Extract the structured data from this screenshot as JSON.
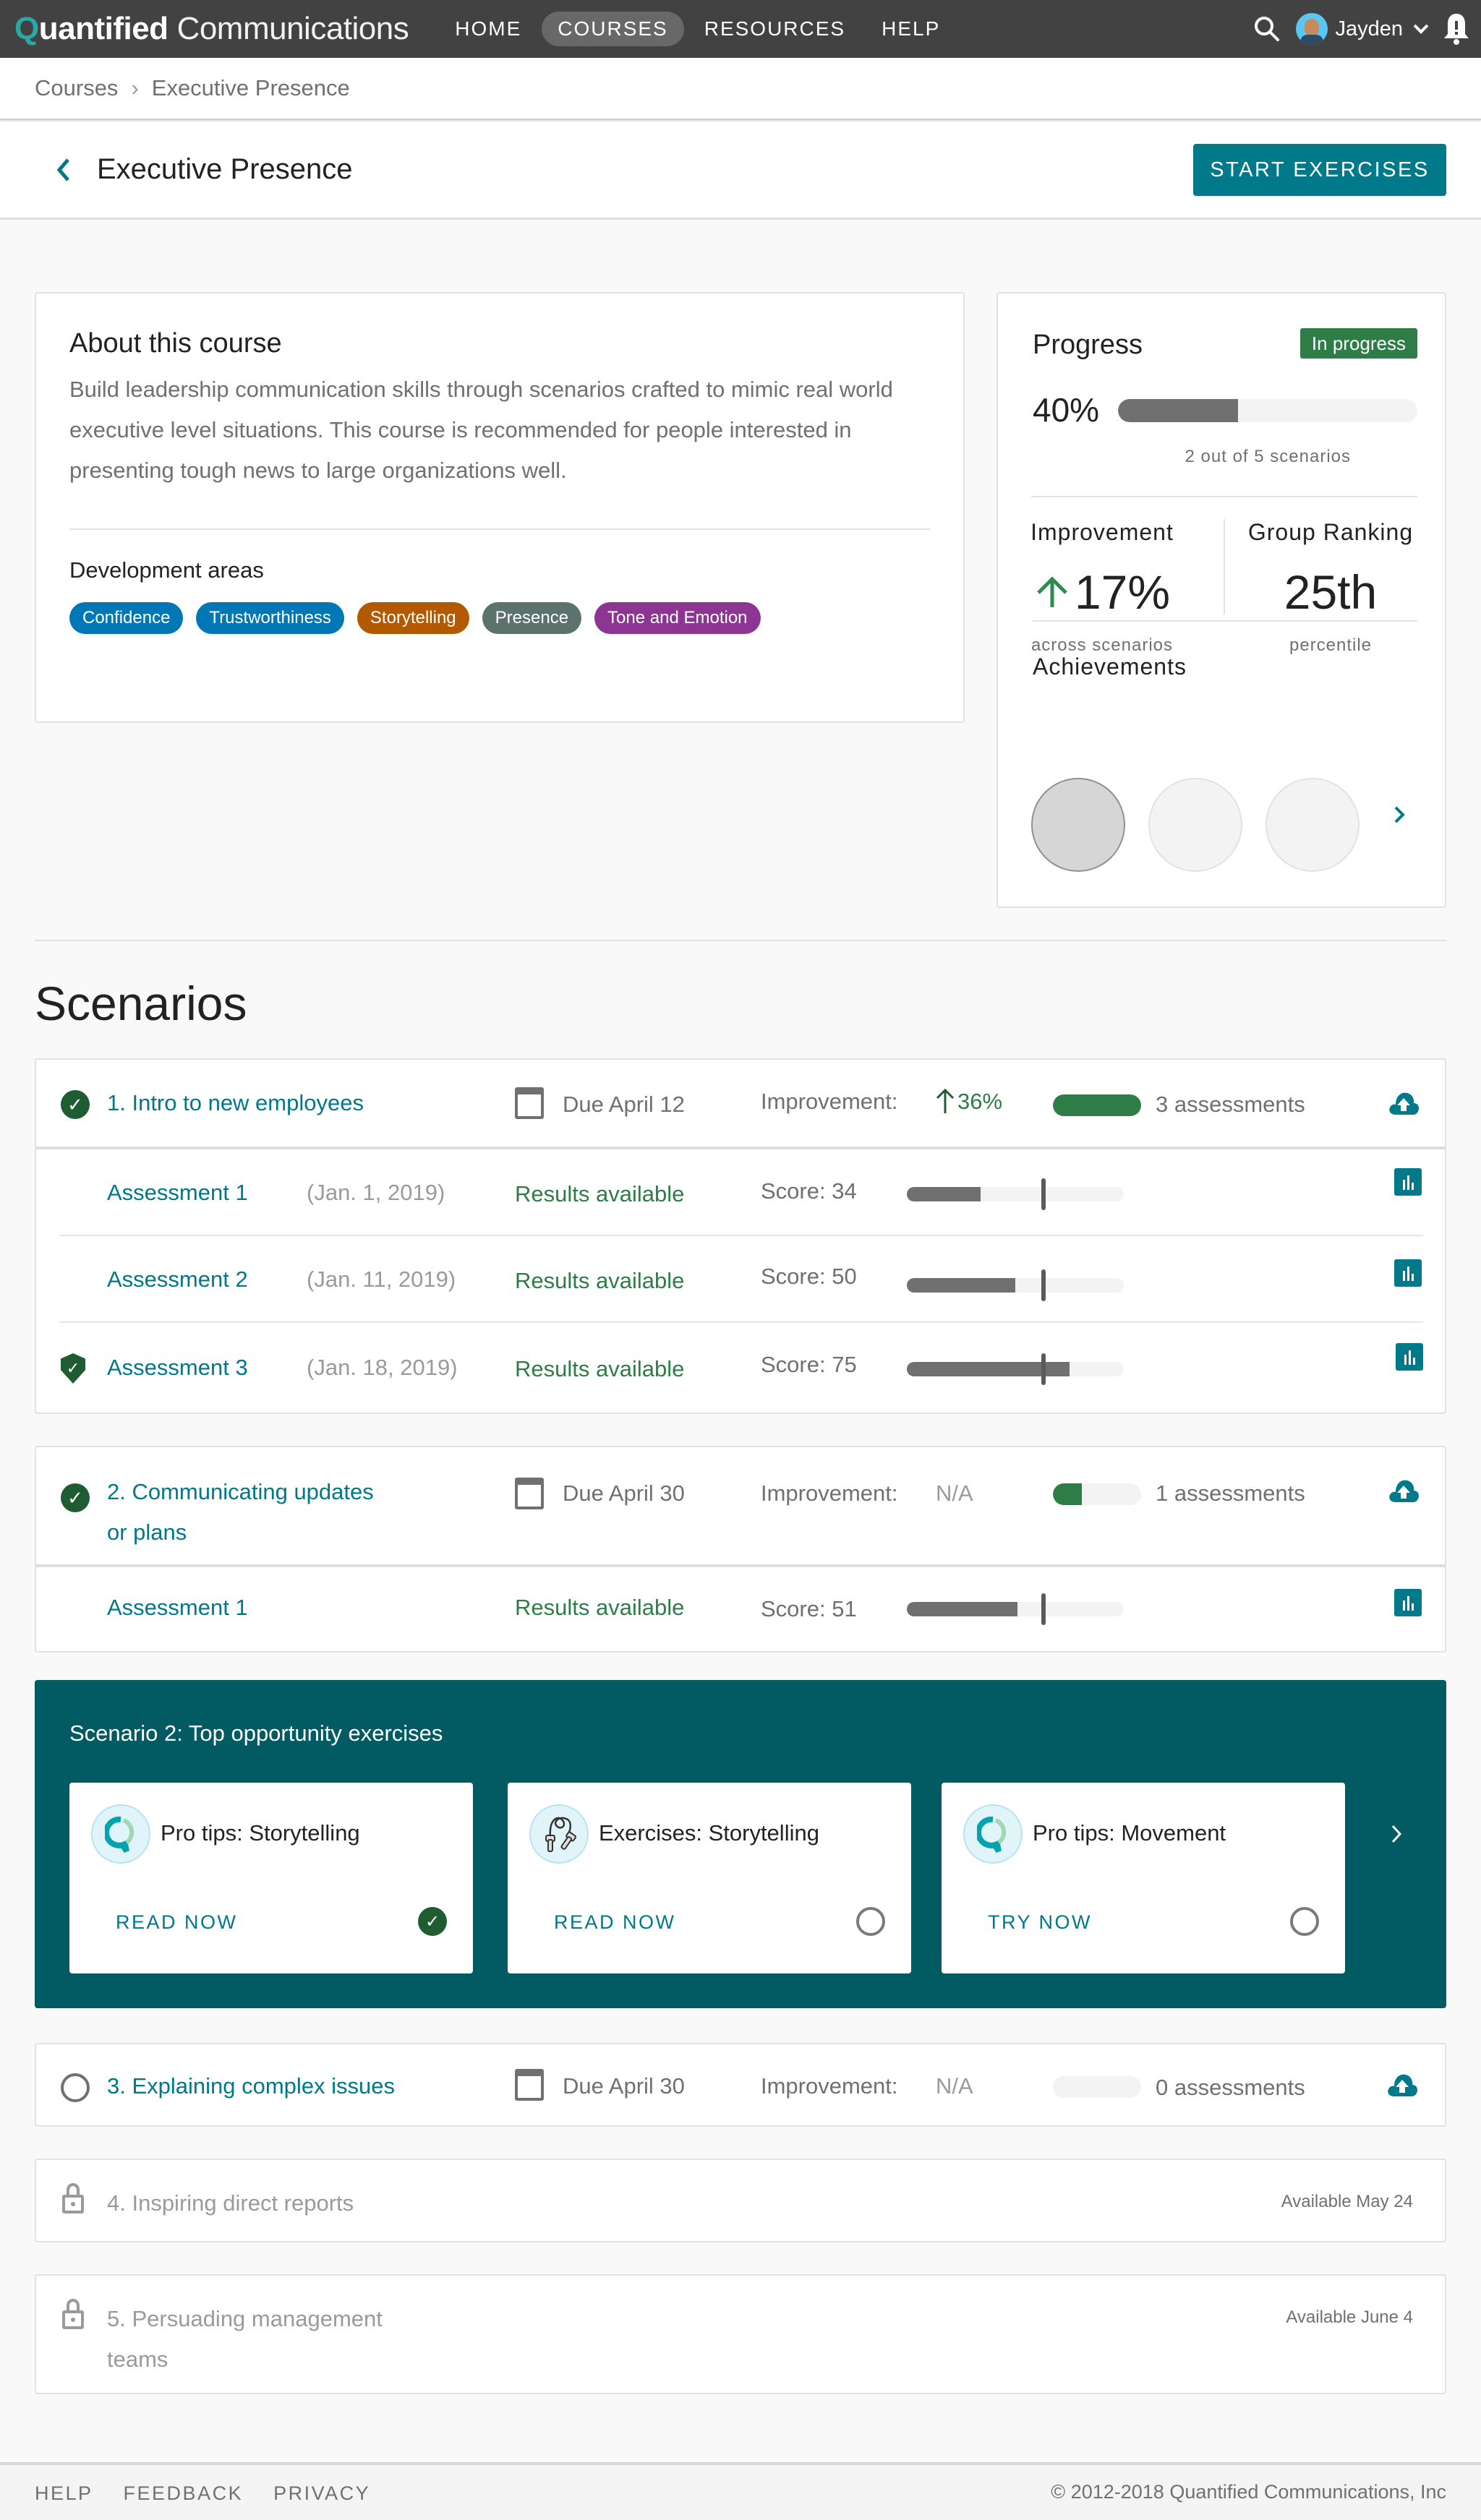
{
  "app": {
    "logo_q": "Q",
    "logo_bold": "uantified",
    "logo_light": "Communications"
  },
  "nav": {
    "items": [
      {
        "label": "HOME",
        "active": false
      },
      {
        "label": "COURSES",
        "active": true
      },
      {
        "label": "RESOURCES",
        "active": false
      },
      {
        "label": "HELP",
        "active": false
      }
    ],
    "user_name": "Jayden",
    "icons": [
      "search-icon",
      "avatar",
      "chevron-down-icon",
      "bell-alert-icon"
    ]
  },
  "breadcrumb": {
    "items": [
      "Courses",
      "Executive Presence"
    ],
    "separator": "›"
  },
  "header": {
    "back_icon": "‹",
    "title": "Executive Presence",
    "start_button": "START EXERCISES"
  },
  "about": {
    "title": "About this course",
    "description": "Build leadership communication skills through scenarios crafted to mimic real world executive level situations. This course is recommended for people interested  in presenting tough news to large organizations well.",
    "dev_areas_title": "Development areas",
    "tags": [
      {
        "label": "Confidence",
        "color": "#0277b5"
      },
      {
        "label": "Trustworthiness",
        "color": "#0277b5"
      },
      {
        "label": "Storytelling",
        "color": "#b35900"
      },
      {
        "label": "Presence",
        "color": "#5b726d"
      },
      {
        "label": "Tone and Emotion",
        "color": "#8c3592"
      }
    ]
  },
  "progress": {
    "title": "Progress",
    "status_badge": "In progress",
    "percent_label": "40%",
    "percent_value": 40,
    "scenarios_label": "2 out of 5 scenarios",
    "improvement": {
      "label": "Improvement",
      "value": "17%",
      "sub": "across scenarios",
      "direction": "up"
    },
    "ranking": {
      "label": "Group Ranking",
      "value": "25th",
      "sub": "percentile"
    },
    "achievements_title": "Achievements",
    "achievements": [
      {
        "earned": true
      },
      {
        "earned": false
      },
      {
        "earned": false
      }
    ],
    "next_icon": "›"
  },
  "scenarios_title": "Scenarios",
  "scenarios": [
    {
      "title": "1. Intro to new employees",
      "status": "complete",
      "due": "Due April 12",
      "improvement_label": "Improvement:",
      "improvement_value": "36%",
      "improvement_direction": "up",
      "assessment_progress": 100,
      "assessments_label": "3 assessments",
      "assessments": [
        {
          "name": "Assessment 1",
          "date": "(Jan. 1, 2019)",
          "status": "Results available",
          "score_label": "Score: 34",
          "score": 34,
          "benchmark": 63,
          "badge": false
        },
        {
          "name": "Assessment 2",
          "date": "(Jan. 11, 2019)",
          "status": "Results available",
          "score_label": "Score: 50",
          "score": 50,
          "benchmark": 63,
          "badge": false
        },
        {
          "name": "Assessment 3",
          "date": "(Jan. 18, 2019)",
          "status": "Results available",
          "score_label": "Score: 75",
          "score": 75,
          "benchmark": 63,
          "badge": true
        }
      ]
    },
    {
      "title_line1": "2. Communicating updates",
      "title_line2": "or plans",
      "status": "complete",
      "due": "Due April 30",
      "improvement_label": "Improvement:",
      "improvement_value": "N/A",
      "assessment_progress": 33,
      "assessments_label": "1 assessments",
      "assessments": [
        {
          "name": "Assessment 1",
          "date": "",
          "status": "Results available",
          "score_label": "Score: 51",
          "score": 51,
          "benchmark": 63,
          "badge": false
        }
      ]
    },
    {
      "title": "3. Explaining complex issues",
      "status": "not-started",
      "due": "Due April 30",
      "improvement_label": "Improvement:",
      "improvement_value": "N/A",
      "assessment_progress": 0,
      "assessments_label": "0 assessments"
    },
    {
      "title": "4. Inspiring direct reports",
      "status": "locked",
      "available": "Available May 24"
    },
    {
      "title_line1": "5. Persuading management",
      "title_line2": "teams",
      "status": "locked",
      "available": "Available June 4"
    }
  ],
  "opportunities": {
    "title": "Scenario 2: Top opportunity exercises",
    "cards": [
      {
        "title": "Pro tips: Storytelling",
        "action": "READ NOW",
        "icon": "qc-logo-icon",
        "done": true
      },
      {
        "title": "Exercises: Storytelling",
        "action": "READ NOW",
        "icon": "jump-rope-icon",
        "done": false
      },
      {
        "title": "Pro tips: Movement",
        "action": "TRY NOW",
        "icon": "qc-logo-icon",
        "done": false
      }
    ],
    "next_icon": "›"
  },
  "footer": {
    "links": [
      "HELP",
      "FEEDBACK",
      "PRIVACY"
    ],
    "copyright": "© 2012-2018 Quantified Communications, Inc"
  },
  "colors": {
    "topbar": "#424242",
    "accent_teal": "#007a8a",
    "success_green": "#2e7d46",
    "panel_teal": "#025a63"
  }
}
